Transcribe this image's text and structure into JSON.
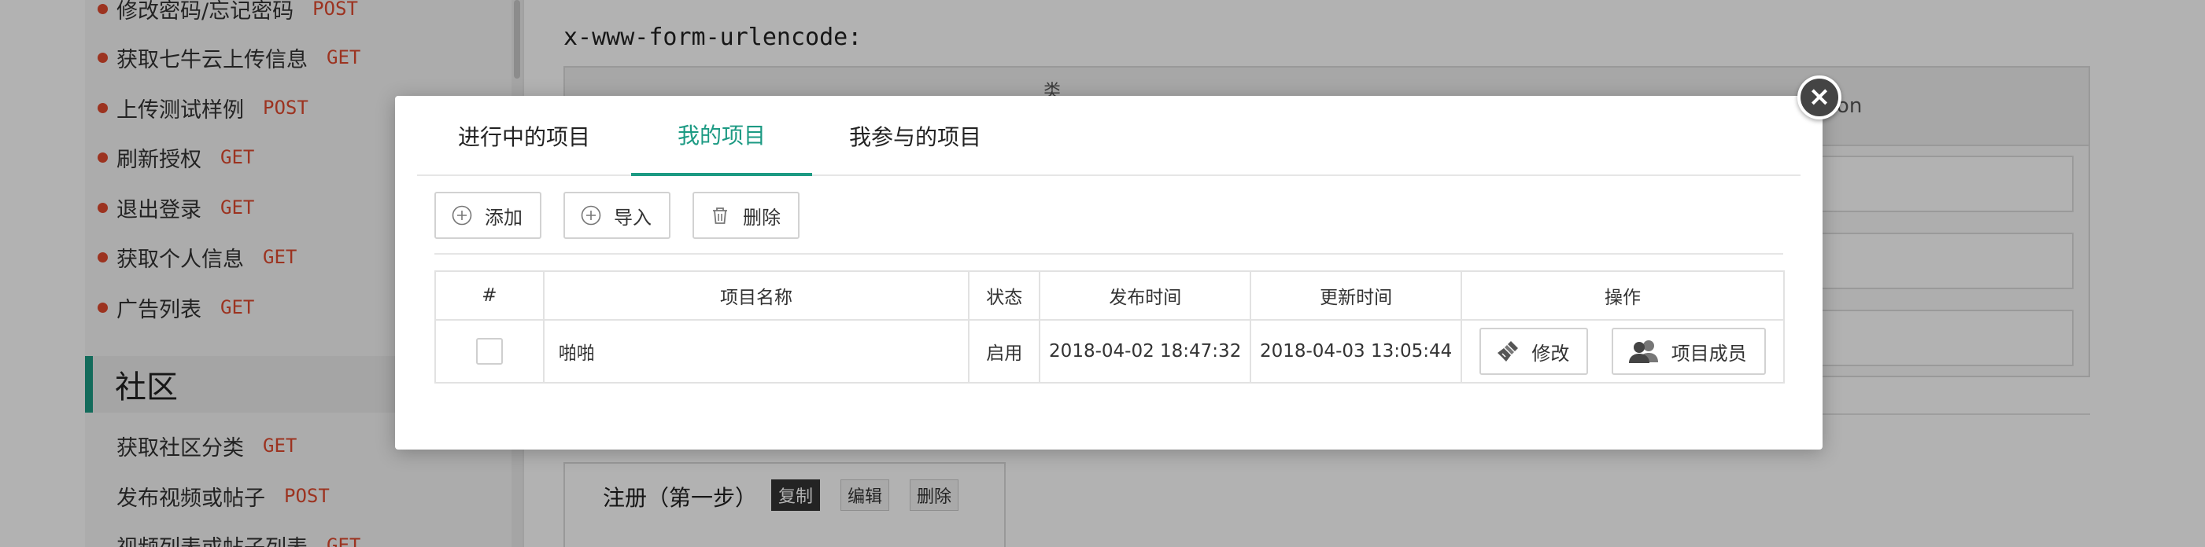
{
  "sidebar": {
    "items": [
      {
        "label": "修改密码/忘记密码",
        "method": "POST",
        "dot": true
      },
      {
        "label": "获取七牛云上传信息",
        "method": "GET",
        "dot": true
      },
      {
        "label": "上传测试样例",
        "method": "POST",
        "dot": true
      },
      {
        "label": "刷新授权",
        "method": "GET",
        "dot": true
      },
      {
        "label": "退出登录",
        "method": "GET",
        "dot": true
      },
      {
        "label": "获取个人信息",
        "method": "GET",
        "dot": true
      },
      {
        "label": "广告列表",
        "method": "GET",
        "dot": true
      }
    ],
    "section": "社区",
    "community_items": [
      {
        "label": "获取社区分类",
        "method": "GET"
      },
      {
        "label": "发布视频或帖子",
        "method": "POST"
      },
      {
        "label": "视频列表或帖子列表",
        "method": "GET"
      }
    ]
  },
  "main": {
    "encode_label": "x-www-form-urlencode:",
    "table_type_header": "类",
    "table_desc_header": "ption",
    "step": {
      "title": "注册（第一步）",
      "copy_label": "复制",
      "edit_label": "编辑",
      "delete_label": "删除"
    }
  },
  "modal": {
    "tabs": [
      "进行中的项目",
      "我的项目",
      "我参与的项目"
    ],
    "active_tab": 1,
    "toolbar": {
      "add_label": "添加",
      "import_label": "导入",
      "delete_label": "删除"
    },
    "table": {
      "headers": [
        "#",
        "项目名称",
        "状态",
        "发布时间",
        "更新时间",
        "操作"
      ],
      "rows": [
        {
          "name": "啪啪",
          "status": "启用",
          "published": "2018-04-02 18:47:32",
          "updated": "2018-04-03 13:05:44",
          "edit_label": "修改",
          "members_label": "项目成员"
        }
      ]
    }
  },
  "colors": {
    "accent": "#1c9a83",
    "method": "#e0492e"
  }
}
